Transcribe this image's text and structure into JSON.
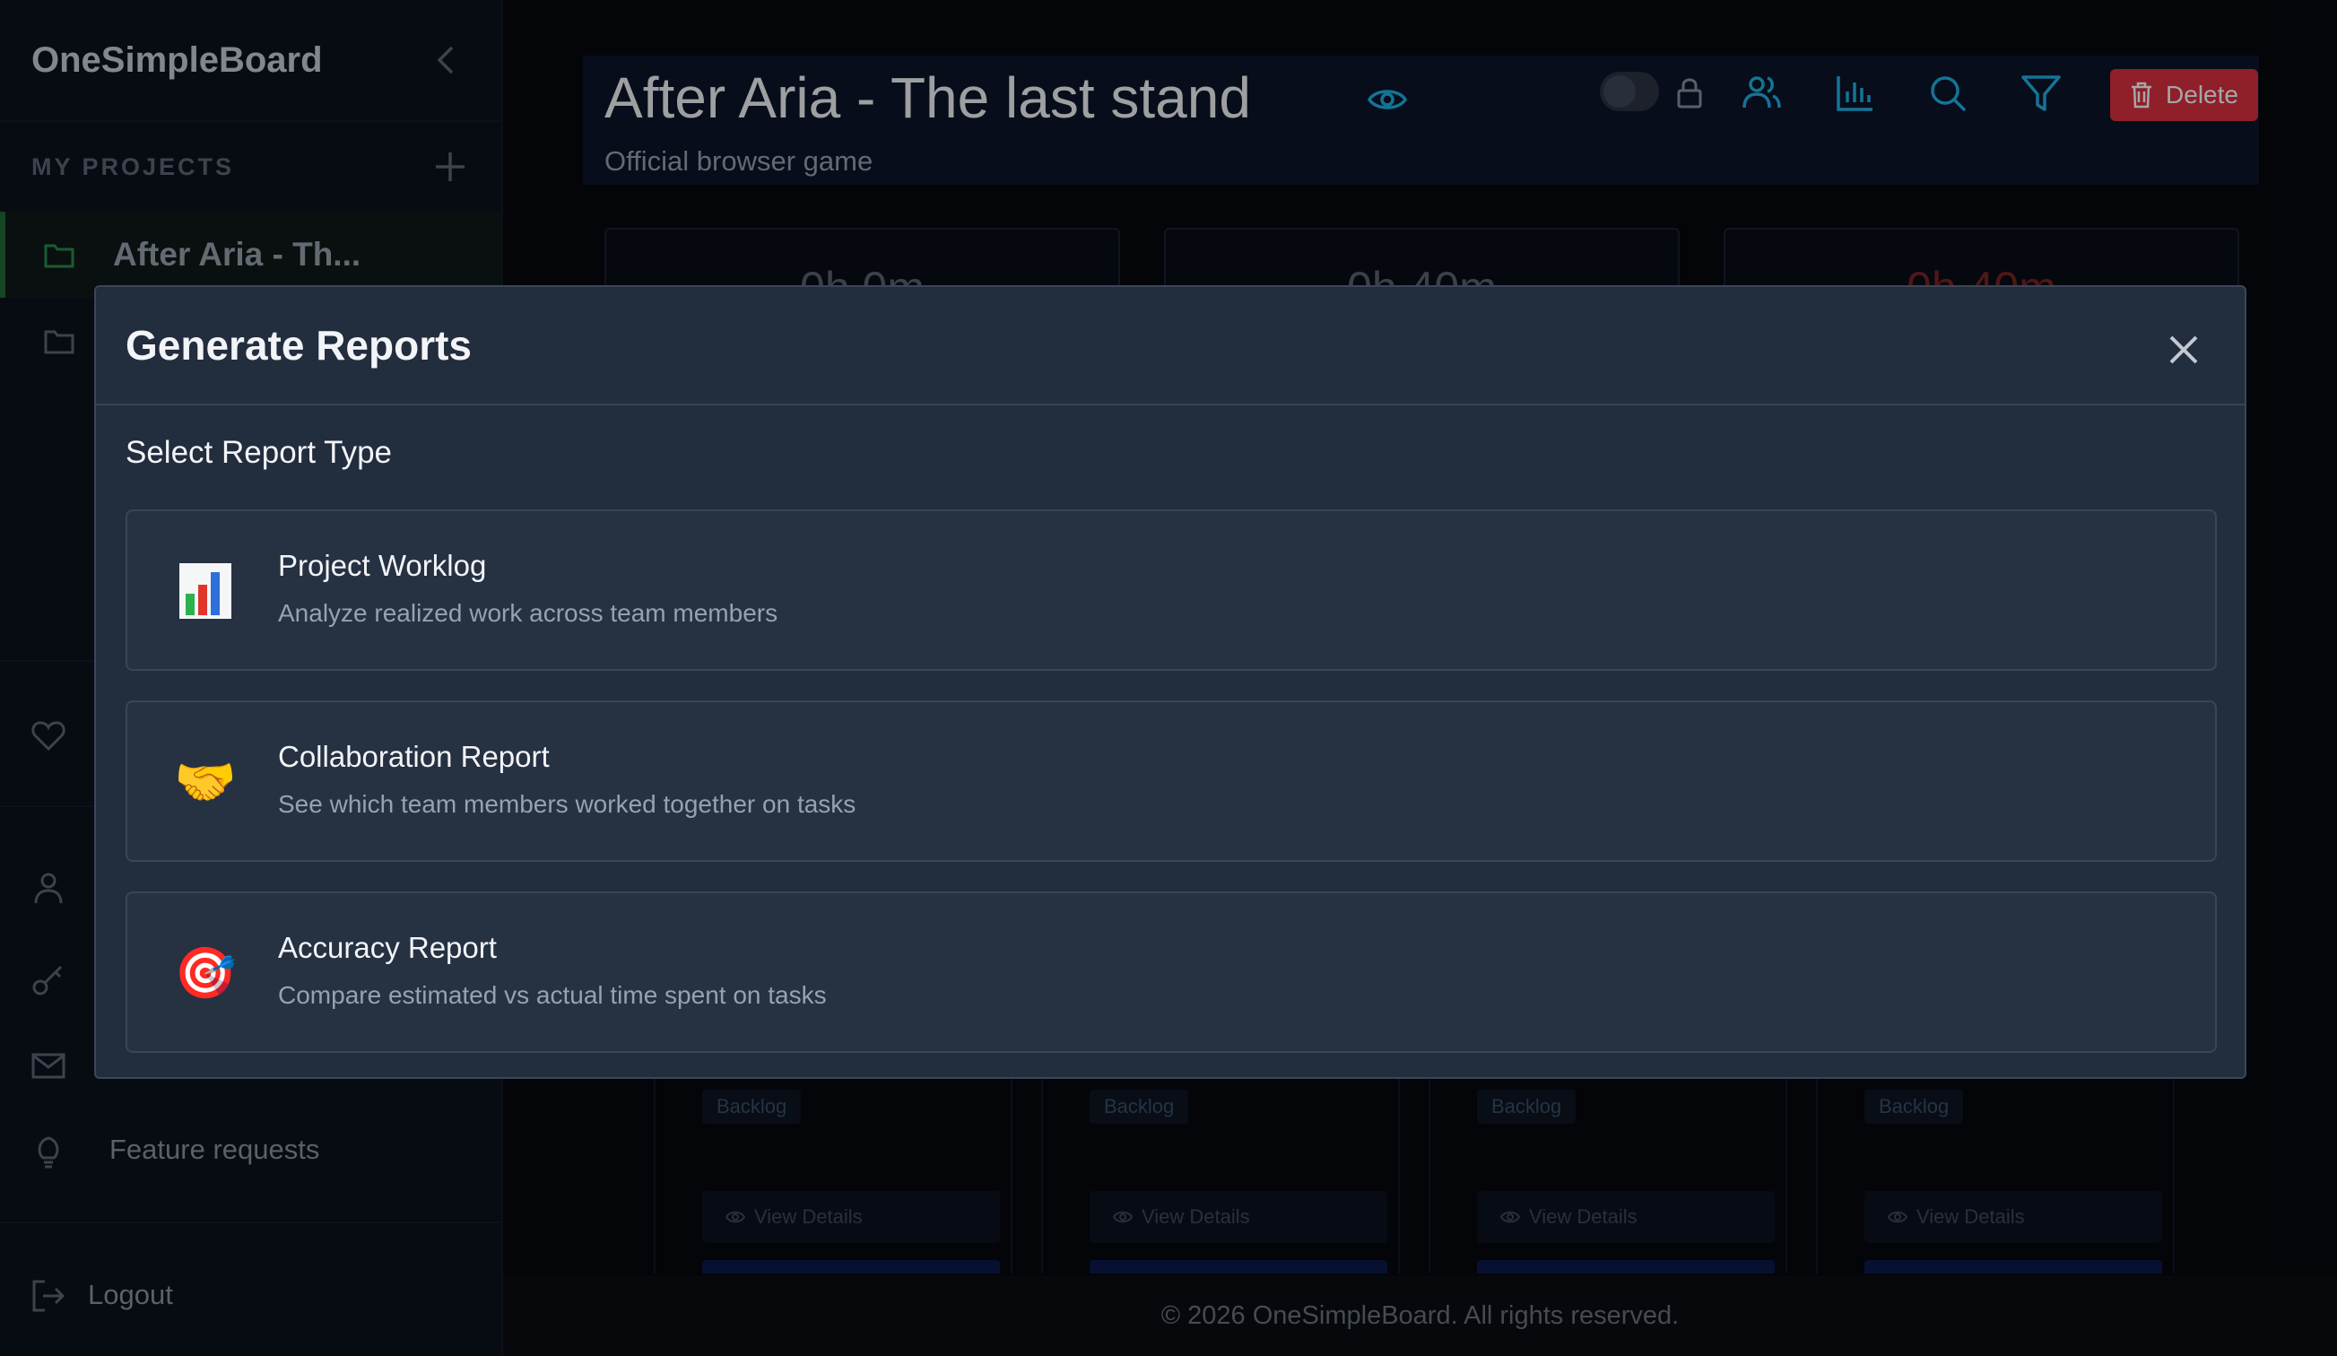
{
  "sidebar": {
    "brand": "OneSimpleBoard",
    "section_title": "MY PROJECTS",
    "projects": [
      {
        "label": "After Aria - Th..."
      },
      {
        "label": ""
      }
    ],
    "feature_requests": "Feature requests",
    "logout": "Logout"
  },
  "header": {
    "title": "After Aria - The last stand",
    "subtitle": "Official browser game",
    "delete_label": "Delete"
  },
  "stats": [
    {
      "value": "0h 0m"
    },
    {
      "value": "0h 40m"
    },
    {
      "value": "0h 40m",
      "color": "#d63a3a"
    }
  ],
  "lanes": [
    {
      "badge": "Backlog",
      "button": "View Details"
    },
    {
      "badge": "Backlog",
      "button": "View Details"
    },
    {
      "badge": "Backlog",
      "button": "View Details"
    },
    {
      "badge": "Backlog",
      "button": "View Details"
    }
  ],
  "footer": "© 2026 OneSimpleBoard. All rights reserved.",
  "modal": {
    "title": "Generate Reports",
    "subtitle": "Select Report Type",
    "options": [
      {
        "icon": "bar-chart-emoji",
        "title": "Project Worklog",
        "description": "Analyze realized work across team members"
      },
      {
        "icon": "handshake-emoji",
        "emoji": "🤝",
        "title": "Collaboration Report",
        "description": "See which team members worked together on tasks"
      },
      {
        "icon": "target-emoji",
        "emoji": "🎯",
        "title": "Accuracy Report",
        "description": "Compare estimated vs actual time spent on tasks"
      }
    ]
  },
  "colors": {
    "accent": "#1fb3e6",
    "danger": "#dc3140",
    "modal_bg": "#222d3d"
  }
}
